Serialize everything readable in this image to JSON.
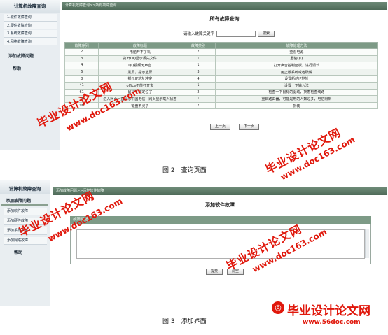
{
  "figure1": {
    "sidebar": {
      "title": "计算机故障查询",
      "items": [
        "1.软件故障查询",
        "2.硬件故障查询",
        "3.系统故障查询",
        "4.网络故障查询"
      ],
      "add_link": "添加故障问题",
      "help": "帮助"
    },
    "breadcrumb": "计算机故障查询>>所有故障查询",
    "page_title": "所有故障查询",
    "search": {
      "label": "请输入故障关键字",
      "value": "",
      "button": "搜索"
    },
    "table": {
      "headers": [
        "故障序列",
        "故障标题",
        "故障类别",
        "故障处理方法"
      ],
      "rows": [
        [
          "2",
          "电脑开不了机",
          "2",
          "查看电源"
        ],
        [
          "3",
          "打开QQ显示丢失文件",
          "1",
          "重装QQ"
        ],
        [
          "4",
          "QQ视频无声音",
          "1",
          "打开声音控制面板，进行调节"
        ],
        [
          "6",
          "黑屏，提示蓝屏",
          "3",
          "用正版系统或者破解"
        ],
        [
          "8",
          "提示IP地址冲突",
          "4",
          "设置新的IP地址"
        ],
        [
          "41",
          "office不能打开文",
          "1",
          "设置一下输入法"
        ],
        [
          "61",
          "鼠标不能定位了",
          "2",
          "检查一下鼠标的驱动，换着检查线路"
        ],
        [
          "76",
          "进入网页一直显示中国电信，网页显示载入状态",
          "1",
          "重启路由器，可能是用的人数过多，电信限制"
        ],
        [
          "98",
          "键盘不灵了",
          "2",
          "拆装"
        ]
      ]
    },
    "pager": {
      "prev": "上一页",
      "next": "下一页"
    },
    "caption": "图 2　查询页面"
  },
  "figure2": {
    "sidebar": {
      "title": "计算机故障查询",
      "section": "添加故障问题",
      "items": [
        "添加软件故障",
        "添加硬件故障",
        "添加系统故障",
        "添加网络故障"
      ],
      "help": "帮助"
    },
    "breadcrumb": "添加故障问题>>添加软件故障",
    "page_title": "添加软件故障",
    "description_label": "故障描述:",
    "buttons": {
      "submit": "提交",
      "reset": "清空"
    },
    "caption": "图 3　添加界面"
  },
  "watermarks": {
    "site_cn": "毕业设计论文网",
    "site_url": "www.doc163.com",
    "logo_text": "毕业设计论文网",
    "logo_url": "www.56doc.com",
    "color": "#e0180c"
  },
  "colors": {
    "header_green": "#5b7865",
    "table_header": "#7d9a86",
    "sidebar_bg": "#e8edf1"
  }
}
